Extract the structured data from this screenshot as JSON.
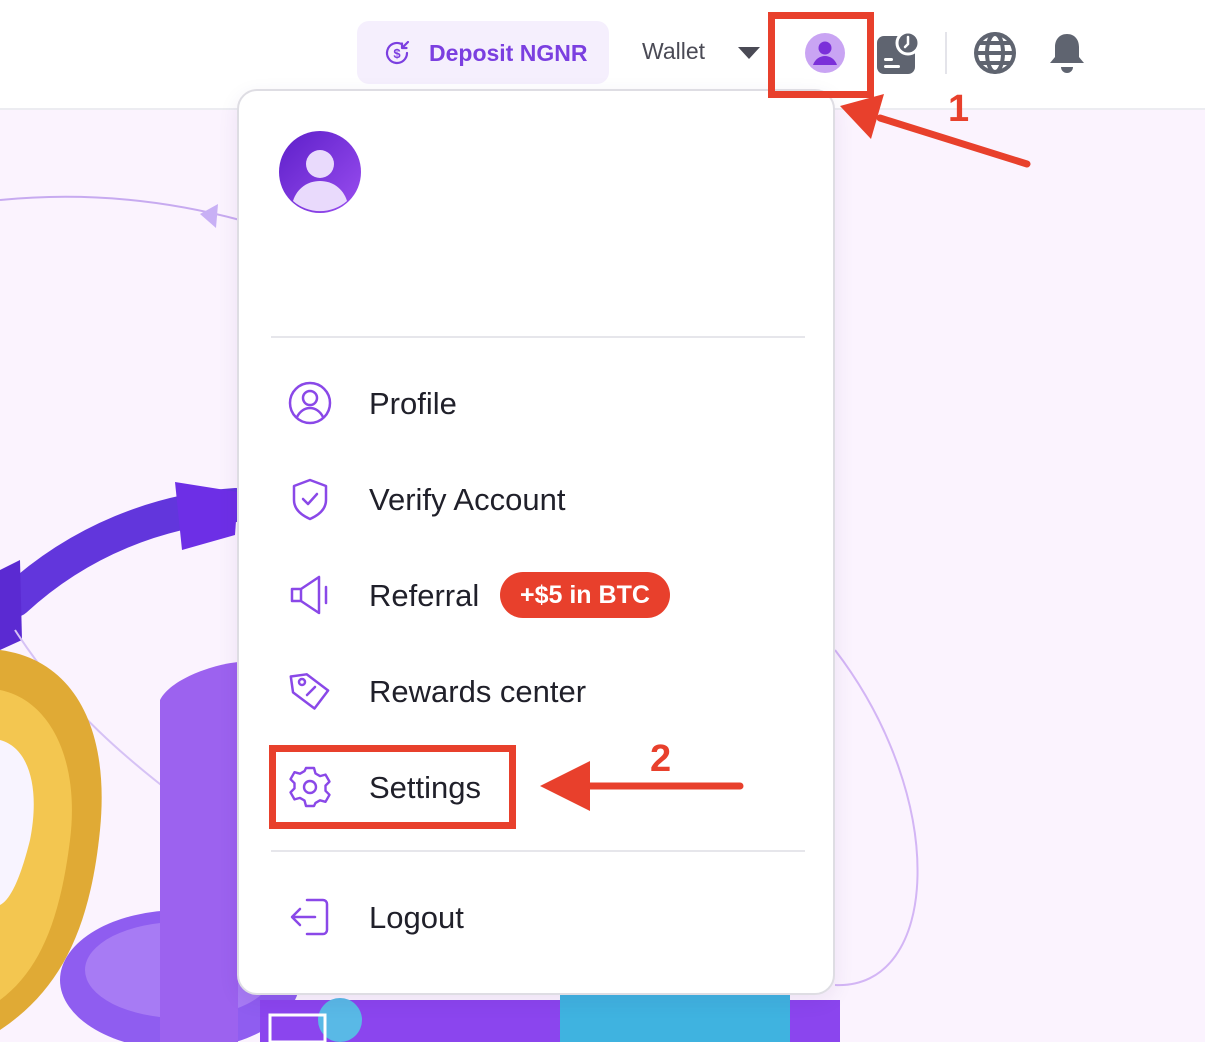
{
  "header": {
    "deposit_label": "Deposit NGNR",
    "wallet_label": "Wallet"
  },
  "menu": {
    "items": [
      {
        "label": "Profile",
        "icon": "user-circle-icon"
      },
      {
        "label": "Verify Account",
        "icon": "shield-check-icon"
      },
      {
        "label": "Referral",
        "icon": "megaphone-icon",
        "badge": "+$5 in BTC"
      },
      {
        "label": "Rewards center",
        "icon": "tag-icon"
      },
      {
        "label": "Settings",
        "icon": "gear-icon"
      }
    ],
    "logout_label": "Logout"
  },
  "annotations": {
    "step1": "1",
    "step2": "2"
  },
  "colors": {
    "accent": "#7b3fe0",
    "annotation": "#e8402c",
    "hero_bg": "#fbf3fe"
  }
}
